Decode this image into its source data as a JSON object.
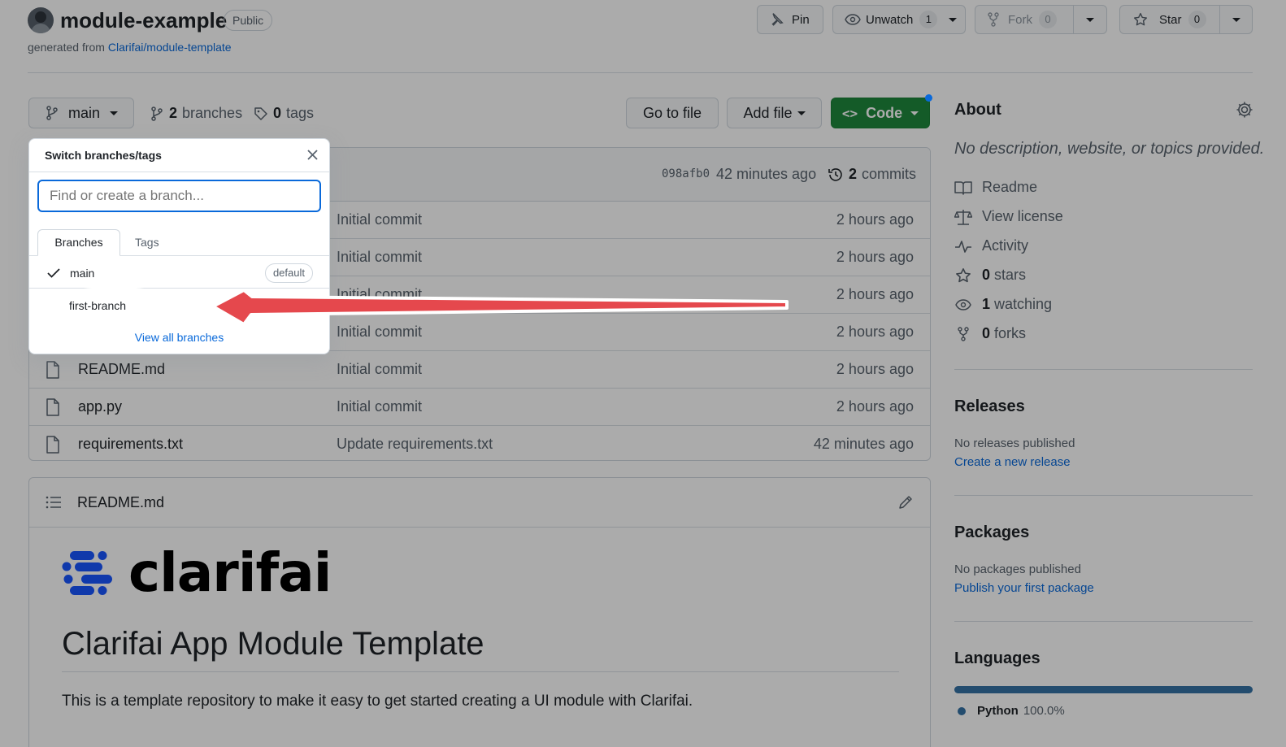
{
  "repo": {
    "name": "module-example",
    "visibility": "Public",
    "generated_prefix": "generated from",
    "template_link": "Clarifai/module-template"
  },
  "actions": {
    "pin": "Pin",
    "unwatch": "Unwatch",
    "unwatch_count": "1",
    "fork": "Fork",
    "fork_count": "0",
    "star": "Star",
    "star_count": "0"
  },
  "toolbar": {
    "branch": "main",
    "branches_count": "2",
    "branches_label": "branches",
    "tags_count": "0",
    "tags_label": "tags",
    "go_to_file": "Go to file",
    "add_file": "Add file",
    "code": "Code"
  },
  "latest_commit": {
    "hash": "098afb0",
    "time": "42 minutes ago",
    "commits_count": "2",
    "commits_label": "commits"
  },
  "files": [
    {
      "name": "",
      "message": "Initial commit",
      "time": "2 hours ago"
    },
    {
      "name": "",
      "message": "Initial commit",
      "time": "2 hours ago"
    },
    {
      "name": "",
      "message": "Initial commit",
      "time": "2 hours ago"
    },
    {
      "name": "",
      "message": "Initial commit",
      "time": "2 hours ago"
    },
    {
      "name": "README.md",
      "message": "Initial commit",
      "time": "2 hours ago"
    },
    {
      "name": "app.py",
      "message": "Initial commit",
      "time": "2 hours ago"
    },
    {
      "name": "requirements.txt",
      "message": "Update requirements.txt",
      "time": "42 minutes ago"
    }
  ],
  "dropdown": {
    "title": "Switch branches/tags",
    "placeholder": "Find or create a branch...",
    "tab_branches": "Branches",
    "tab_tags": "Tags",
    "branches": [
      {
        "name": "main",
        "badge": "default"
      },
      {
        "name": "first-branch",
        "badge": ""
      }
    ],
    "view_all": "View all branches"
  },
  "readme": {
    "filename": "README.md",
    "logo_text": "clarifai",
    "heading": "Clarifai App Module Template",
    "body": "This is a template repository to make it easy to get started creating a UI module with Clarifai."
  },
  "about": {
    "title": "About",
    "description": "No description, website, or topics provided.",
    "readme": "Readme",
    "license": "View license",
    "activity": "Activity",
    "stars_count": "0",
    "stars_label": "stars",
    "watching_count": "1",
    "watching_label": "watching",
    "forks_count": "0",
    "forks_label": "forks"
  },
  "releases": {
    "title": "Releases",
    "none": "No releases published",
    "link": "Create a new release"
  },
  "packages": {
    "title": "Packages",
    "none": "No packages published",
    "link": "Publish your first package"
  },
  "languages": {
    "title": "Languages",
    "items": [
      {
        "name": "Python",
        "percent": "100.0%",
        "color": "#3572A5"
      }
    ]
  },
  "colors": {
    "primary_green": "#1f883d",
    "link_blue": "#0969da",
    "arrow_red": "#e5484d"
  }
}
